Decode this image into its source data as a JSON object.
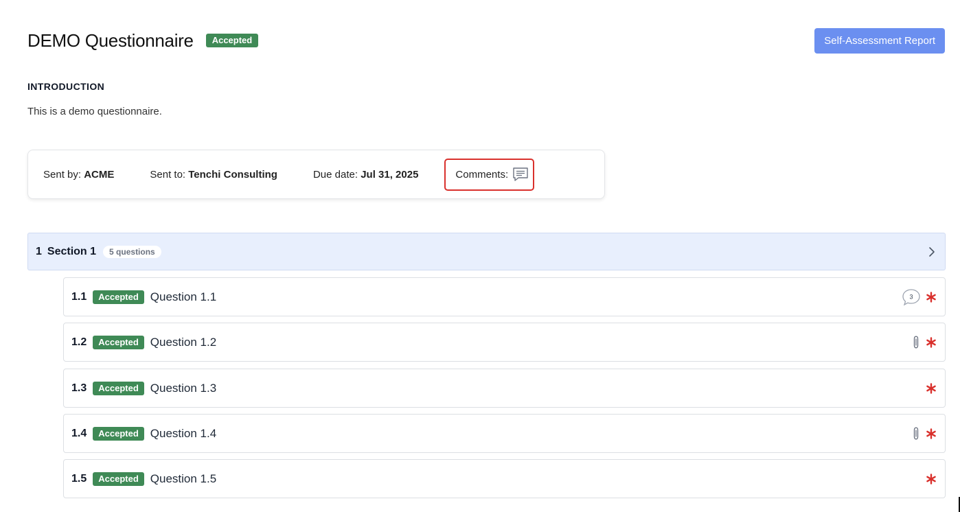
{
  "header": {
    "title": "DEMO Questionnaire",
    "status": "Accepted",
    "report_button": "Self-Assessment Report"
  },
  "intro": {
    "heading": "INTRODUCTION",
    "text": "This is a demo questionnaire."
  },
  "info": {
    "sent_by_label": "Sent by:",
    "sent_by_value": "ACME",
    "sent_to_label": "Sent to:",
    "sent_to_value": "Tenchi Consulting",
    "due_label": "Due date:",
    "due_value": "Jul 31, 2025",
    "comments_label": "Comments:"
  },
  "section": {
    "number": "1",
    "title": "Section 1",
    "count": "5 questions"
  },
  "questions": [
    {
      "number": "1.1",
      "status": "Accepted",
      "text": "Question 1.1",
      "comment_count": "3",
      "icon": "comment-bubble-icon"
    },
    {
      "number": "1.2",
      "status": "Accepted",
      "text": "Question 1.2",
      "icon": "paperclip-icon"
    },
    {
      "number": "1.3",
      "status": "Accepted",
      "text": "Question 1.3"
    },
    {
      "number": "1.4",
      "status": "Accepted",
      "text": "Question 1.4",
      "icon": "paperclip-icon"
    },
    {
      "number": "1.5",
      "status": "Accepted",
      "text": "Question 1.5"
    }
  ],
  "colors": {
    "accepted": "#3f8a56",
    "primary_button": "#6b8ff0",
    "required": "#d9302c",
    "section_bg": "#e8effd"
  }
}
